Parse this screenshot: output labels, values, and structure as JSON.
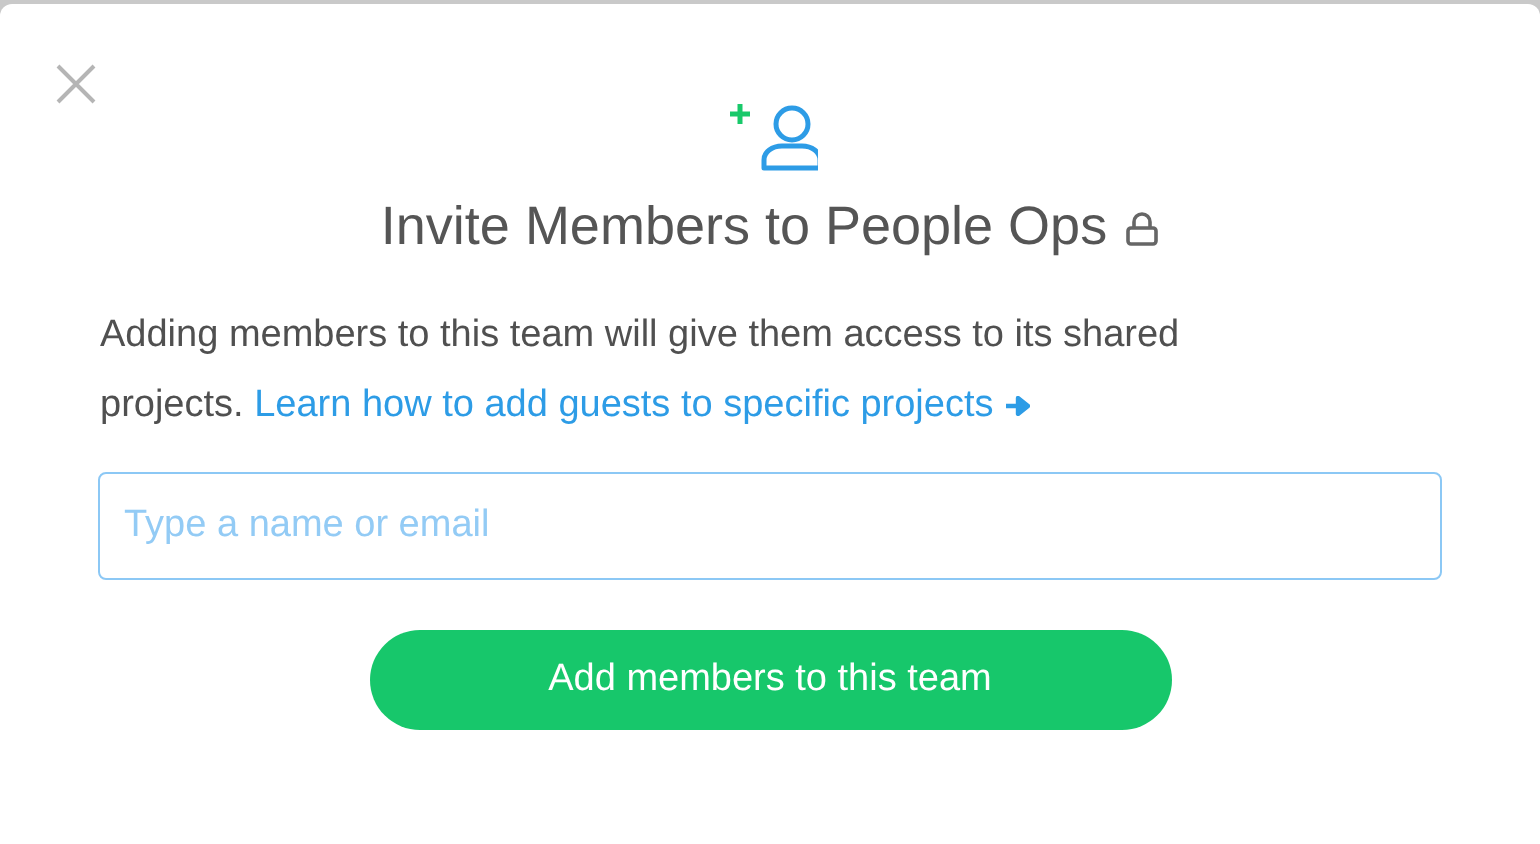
{
  "dialog": {
    "title": "Invite Members to People Ops",
    "description": "Adding members to this team will give them access to its shared projects.",
    "link": "Learn how to add guests to specific projects",
    "search": {
      "placeholder": "Type a name or email"
    },
    "button": "Add members to this team"
  }
}
